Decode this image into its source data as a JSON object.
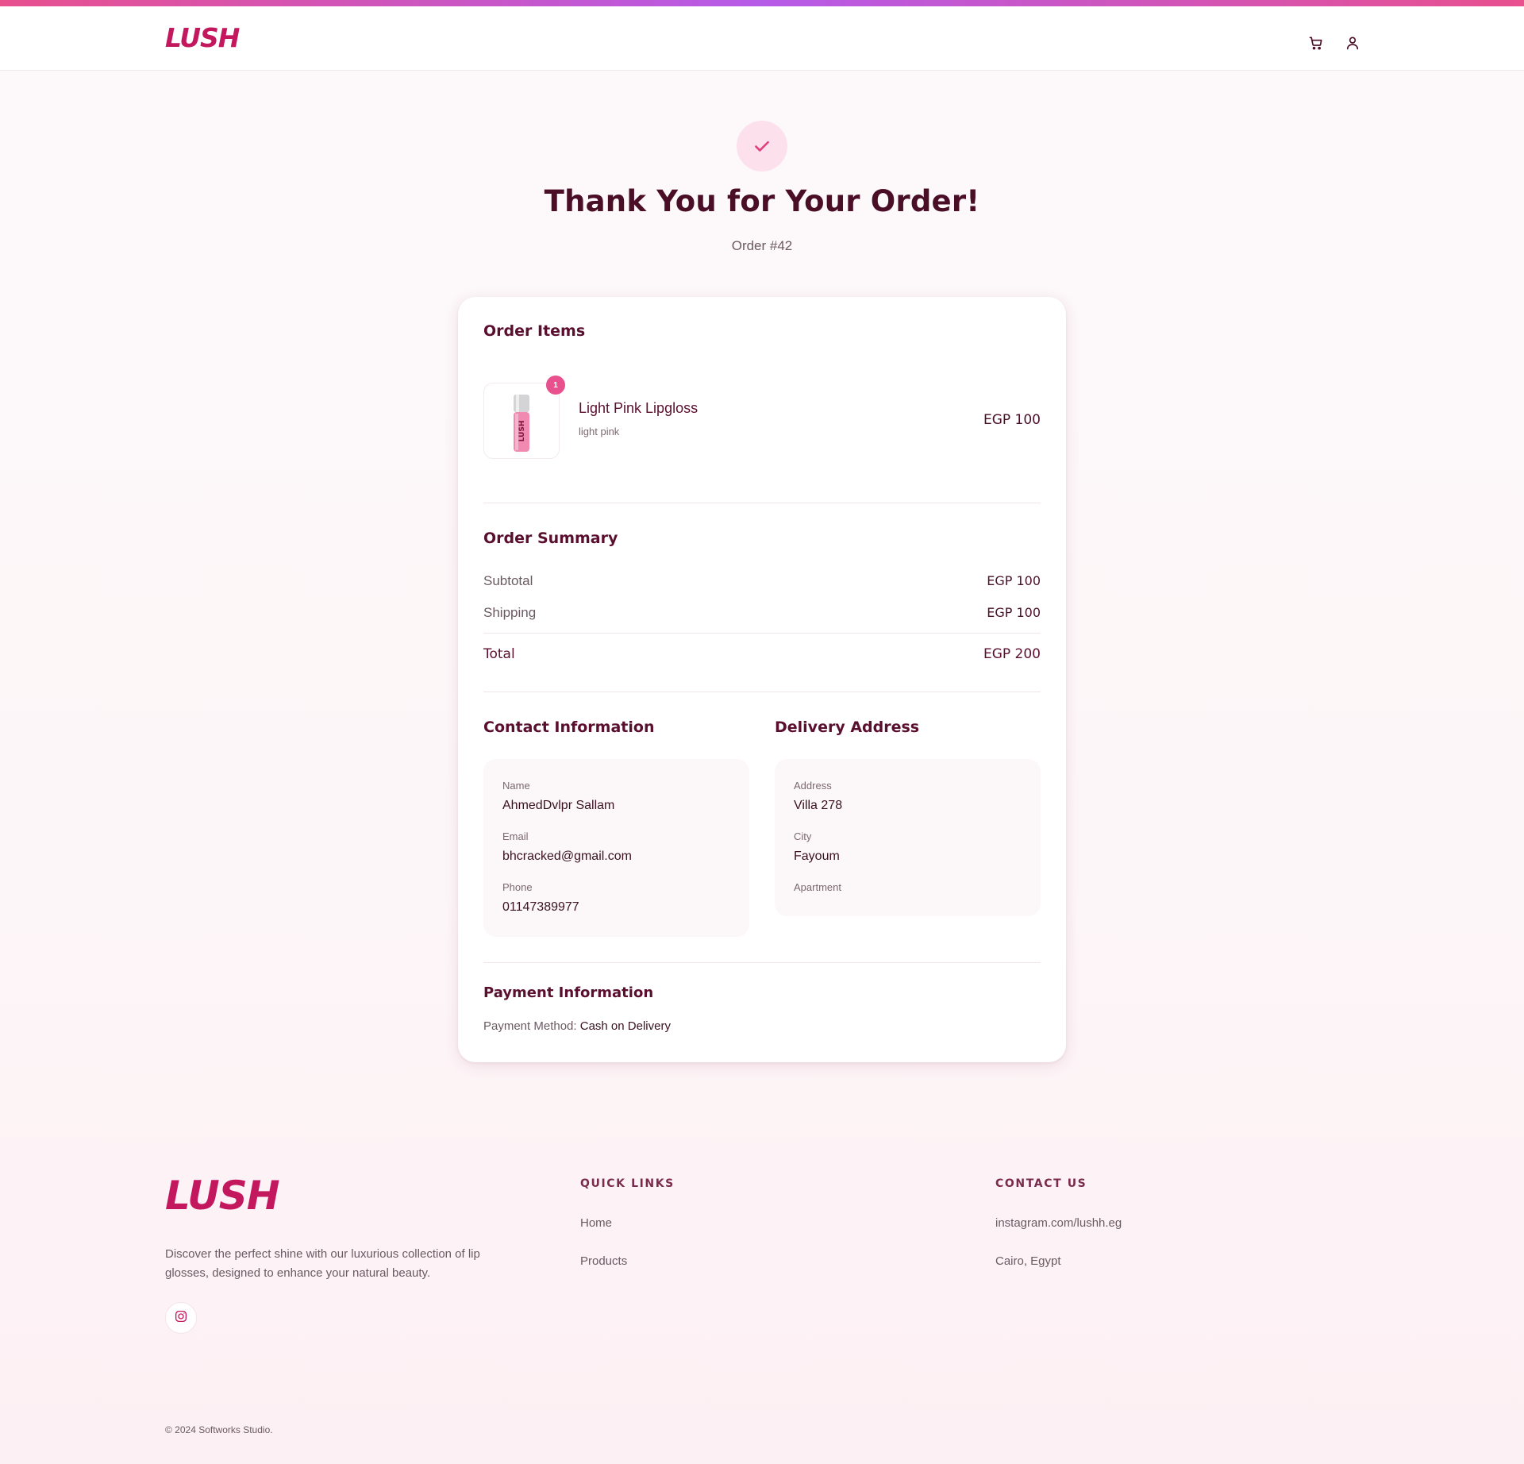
{
  "brand": {
    "logo_text": "LUSH",
    "accent_color": "#c4185e"
  },
  "header": {
    "icons": [
      "cart-icon",
      "user-icon"
    ]
  },
  "confirmation": {
    "title": "Thank You for Your Order!",
    "order_number": "Order #42"
  },
  "order_items": {
    "heading": "Order Items",
    "items": [
      {
        "name": "Light Pink Lipgloss",
        "variant": "light pink",
        "quantity": "1",
        "price": "EGP 100"
      }
    ]
  },
  "summary": {
    "heading": "Order Summary",
    "subtotal_label": "Subtotal",
    "subtotal_value": "EGP 100",
    "shipping_label": "Shipping",
    "shipping_value": "EGP 100",
    "total_label": "Total",
    "total_value": "EGP 200"
  },
  "contact": {
    "heading": "Contact Information",
    "name_label": "Name",
    "name_value": "AhmedDvlpr Sallam",
    "email_label": "Email",
    "email_value": "bhcracked@gmail.com",
    "phone_label": "Phone",
    "phone_value": "01147389977"
  },
  "delivery": {
    "heading": "Delivery Address",
    "address_label": "Address",
    "address_value": "Villa 278",
    "city_label": "City",
    "city_value": "Fayoum",
    "apartment_label": "Apartment",
    "apartment_value": ""
  },
  "payment": {
    "heading": "Payment Information",
    "method_label": "Payment Method:",
    "method_value": "Cash on Delivery"
  },
  "footer": {
    "description": "Discover the perfect shine with our luxurious collection of lip glosses, designed to enhance your natural beauty.",
    "quick_links_heading": "QUICK LINKS",
    "quick_links": [
      "Home",
      "Products"
    ],
    "contact_heading": "CONTACT US",
    "contact_items": [
      "instagram.com/lushh.eg",
      "Cairo, Egypt"
    ],
    "copyright": "© 2024 Softworks Studio."
  }
}
